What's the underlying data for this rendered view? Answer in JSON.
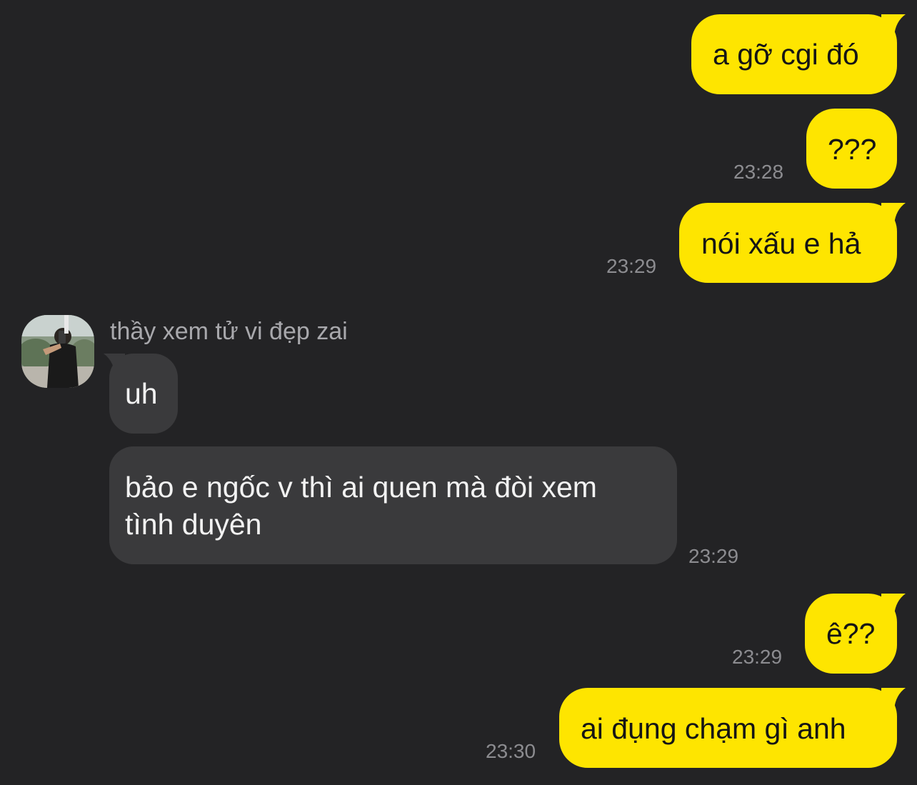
{
  "conversation": {
    "sender_name": "thầy xem tử vi đẹp zai",
    "messages": [
      {
        "from": "me",
        "text": "a gỡ cgi đó",
        "time": ""
      },
      {
        "from": "me",
        "text": "???",
        "time": "23:28"
      },
      {
        "from": "me",
        "text": "nói xấu e hả",
        "time": "23:29"
      },
      {
        "from": "them",
        "text": "uh",
        "time": ""
      },
      {
        "from": "them",
        "text_line1": "bảo e ngốc v thì ai quen mà đòi xem",
        "text_line2": "tình duyên",
        "time": "23:29"
      },
      {
        "from": "me",
        "text": "ê??",
        "time": "23:29"
      },
      {
        "from": "me",
        "text": "ai đụng chạm gì anh",
        "time": "23:30"
      }
    ]
  },
  "colors": {
    "background": "#232325",
    "outgoing_bubble": "#fee500",
    "incoming_bubble": "#3a3a3c",
    "timestamp": "#8c8c90",
    "sender_name": "#a8a8ac"
  },
  "icons": {
    "avatar": "user-avatar-photo"
  }
}
